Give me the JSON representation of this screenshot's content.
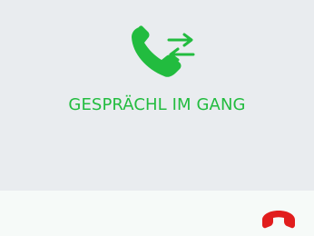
{
  "call": {
    "status_text": "GESPRÄCHL IM GANG",
    "icon": "phone-transfer-icon",
    "status_color": "#22bc3f"
  },
  "actions": {
    "hangup_icon": "end-call-icon",
    "hangup_color": "#e11d1d"
  },
  "colors": {
    "panel_background": "#e9ecef",
    "bar_background": "#f6faf8"
  }
}
